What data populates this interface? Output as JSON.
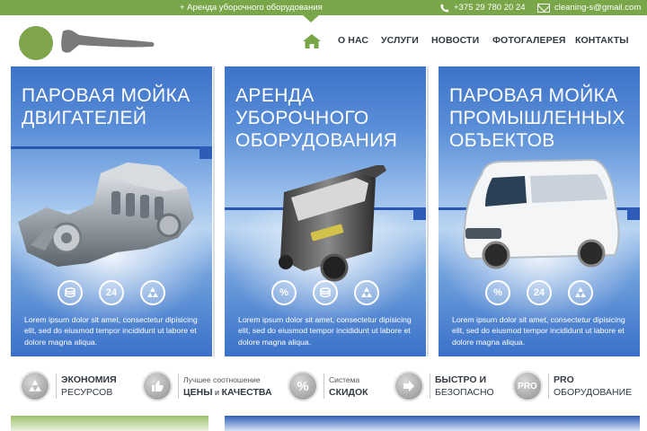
{
  "topbar": {
    "promo": "+ Аренда уборочного оборудования",
    "phone": "+375 29 780 20 24",
    "email": "cleaning-s@gmail.com"
  },
  "nav": {
    "items": [
      {
        "label": "О НАС"
      },
      {
        "label": "УСЛУГИ"
      },
      {
        "label": "НОВОСТИ"
      },
      {
        "label": "ФОТОГАЛЕРЕЯ"
      },
      {
        "label": "КОНТАКТЫ"
      }
    ]
  },
  "cards": [
    {
      "title": "Паровая мойка двигателей",
      "desc": "Lorem ipsum dolor sit amet, consectetur dipisicing elit, sed do eiusmod tempor incididunt ut labore et dolore magna aliqua.",
      "icons": [
        "coins-icon",
        "24-hours-icon",
        "recycle-icon"
      ],
      "image": "engine-image"
    },
    {
      "title": "Аренда уборочного оборудования",
      "desc": "Lorem ipsum dolor sit amet, consectetur dipisicing elit, sed do eiusmod tempor incididunt ut labore et dolore magna aliqua.",
      "icons": [
        "percent-icon",
        "coins-icon",
        "recycle-icon"
      ],
      "image": "steam-cleaner-image"
    },
    {
      "title": "Паровая мойка промышленных объектов",
      "desc": "Lorem ipsum dolor sit amet, consectetur dipisicing elit, sed do eiusmod tempor incididunt ut labore et dolore magna aliqua.",
      "icons": [
        "percent-icon",
        "24-hours-icon",
        "recycle-icon"
      ],
      "image": "van-image"
    }
  ],
  "icon_text": {
    "percent": "%",
    "hours": "24",
    "pro": "PRO"
  },
  "benefits": [
    {
      "line1": "ЭКОНОМИЯ",
      "line2": "РЕСУРСОВ",
      "icon": "recycle-icon"
    },
    {
      "line1": "Лучшее соотношение",
      "line2a": "ЦЕНЫ",
      "line2b": " и ",
      "line2c": "КАЧЕСТВА",
      "icon": "thumbs-up-icon"
    },
    {
      "line1": "Система",
      "line2": "СКИДОК",
      "icon": "percent-icon"
    },
    {
      "line1": "БЫСТРО И",
      "line2": "БЕЗОПАСНО",
      "icon": "arrow-right-icon"
    },
    {
      "line1": "PRO",
      "line2": "ОБОРУДОВАНИЕ",
      "icon": "pro-icon"
    }
  ],
  "colors": {
    "accent_green": "#7aa64a",
    "card_blue": "#3d72c8",
    "text_dark": "#333a44"
  }
}
